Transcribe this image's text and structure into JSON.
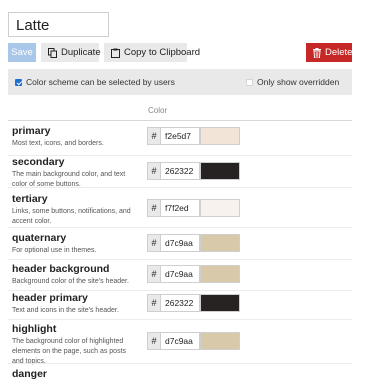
{
  "scheme": {
    "name": "Latte"
  },
  "toolbar": {
    "save_label": "Save",
    "duplicate_label": "Duplicate",
    "copy_label": "Copy to Clipboard",
    "delete_label": "Delete"
  },
  "options": {
    "user_selectable_label": "Color scheme can be selected by users",
    "user_selectable_checked": true,
    "only_overridden_label": "Only show overridden",
    "only_overridden_checked": false
  },
  "table": {
    "column_header": "Color",
    "rows": [
      {
        "name": "primary",
        "description": "Most text, icons, and borders.",
        "hex": "f2e5d7",
        "color": "#f2e5d7"
      },
      {
        "name": "secondary",
        "description": "The main background color, and text color of some buttons.",
        "hex": "262322",
        "color": "#262322"
      },
      {
        "name": "tertiary",
        "description": "Links, some buttons, notifications, and accent color.",
        "hex": "f7f2ed",
        "color": "#f7f2ed"
      },
      {
        "name": "quaternary",
        "description": "For optional use in themes.",
        "hex": "d7c9aa",
        "color": "#d7c9aa"
      },
      {
        "name": "header background",
        "description": "Background color of the site's header.",
        "hex": "d7c9aa",
        "color": "#d7c9aa"
      },
      {
        "name": "header primary",
        "description": "Text and icons in the site's header.",
        "hex": "262322",
        "color": "#262322"
      },
      {
        "name": "highlight",
        "description": "The background color of highlighted elements on the page, such as posts and topics.",
        "hex": "d7c9aa",
        "color": "#d7c9aa"
      },
      {
        "name": "danger",
        "description": "",
        "hex": "",
        "color": ""
      }
    ]
  },
  "icons": {
    "duplicate": "copy-icon",
    "copy": "clipboard-icon",
    "delete": "trash-icon"
  },
  "colors": {
    "save_button_bg": "#a9c7e8",
    "delete_button_bg": "#c62828",
    "checkbox_checked": "#1f6fd1"
  }
}
